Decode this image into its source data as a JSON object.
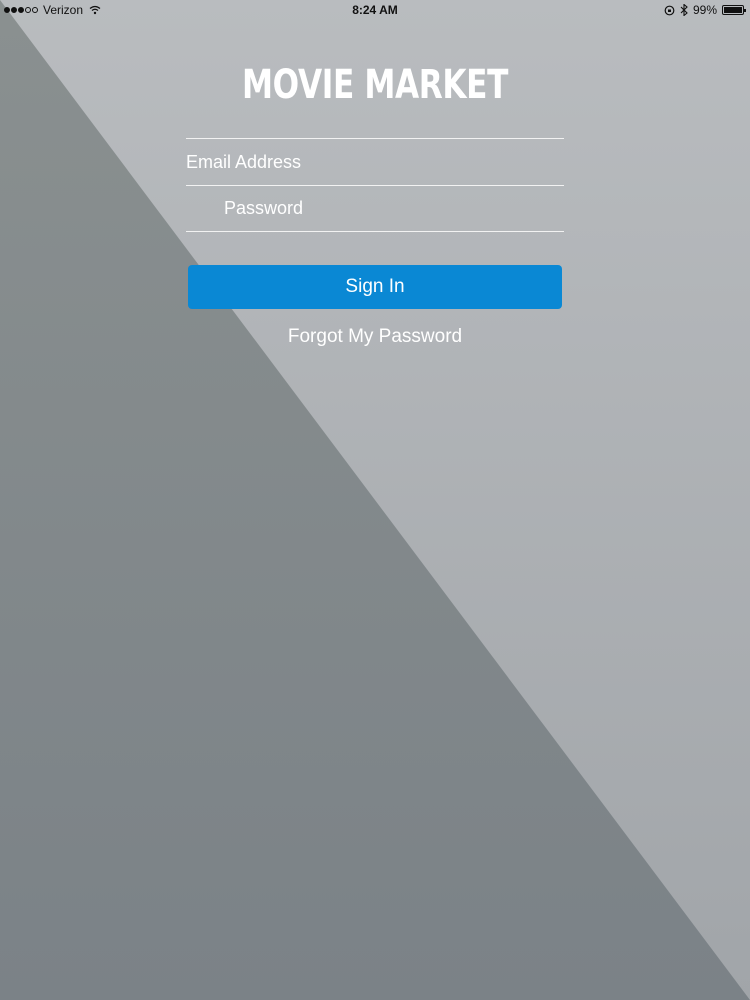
{
  "status_bar": {
    "carrier": "Verizon",
    "time": "8:24 AM",
    "battery_percent": "99%",
    "battery_level": 0.99,
    "signal_bars_filled": 3,
    "signal_bars_total": 5
  },
  "login": {
    "app_title": "MOVIE MARKET",
    "email_placeholder": "Email Address",
    "password_placeholder": "Password",
    "sign_in_label": "Sign In",
    "forgot_label": "Forgot My Password"
  },
  "colors": {
    "primary_button": "#0a88d4",
    "background_light": "#a9adb1",
    "background_dark": "#808689"
  }
}
